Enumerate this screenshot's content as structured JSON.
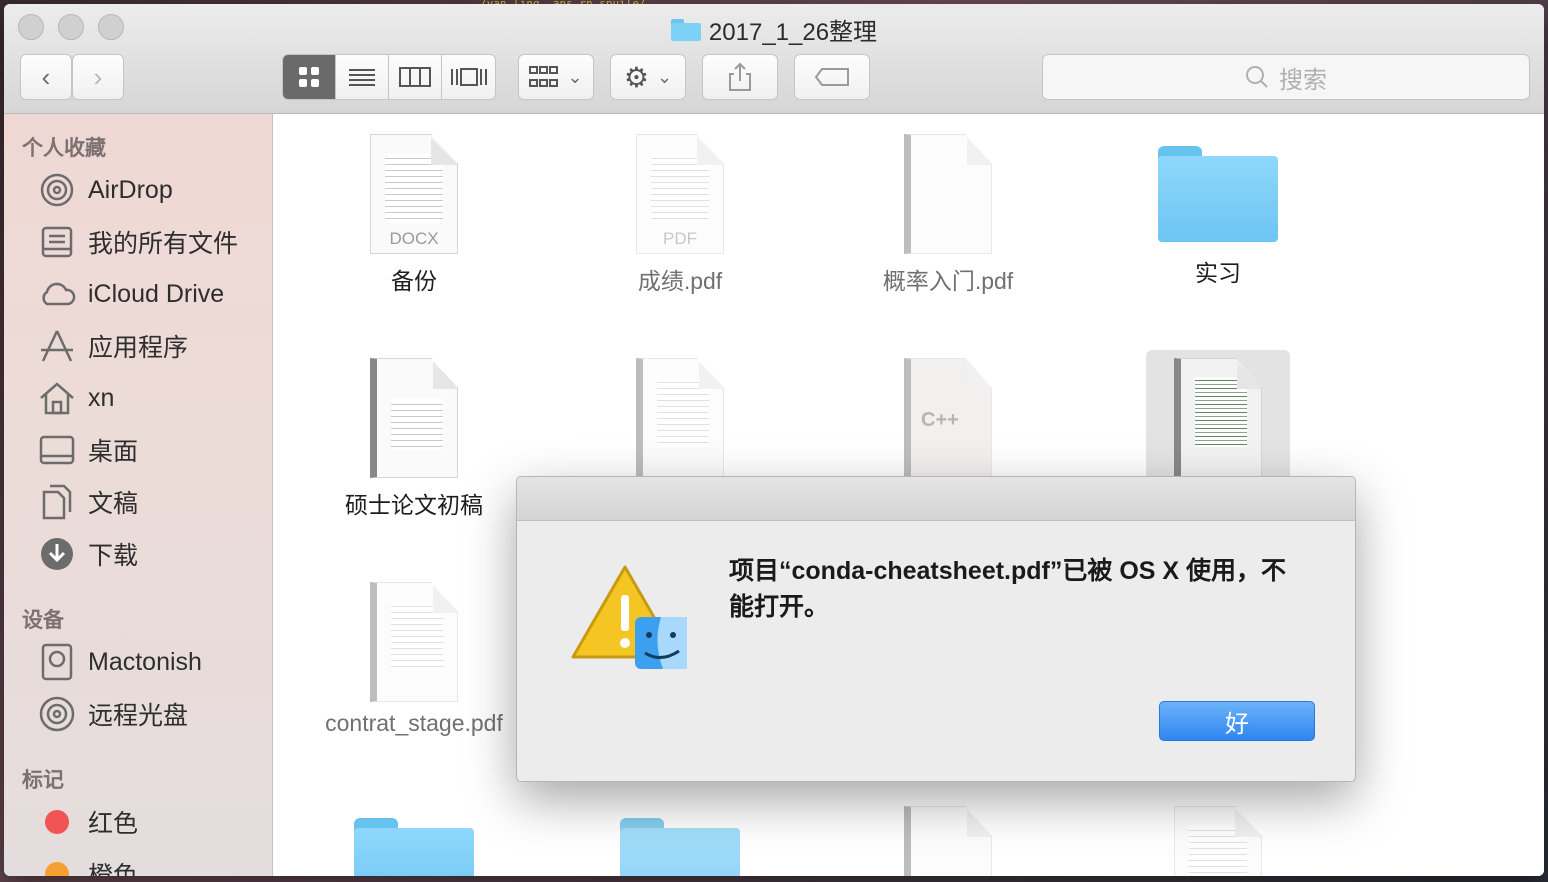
{
  "background_text": "/yan.ling. ans.rn.spuile/",
  "window": {
    "title": "2017_1_26整理"
  },
  "toolbar": {
    "back_icon": "chevron-left-icon",
    "forward_icon": "chevron-right-icon",
    "view_modes": [
      "icon-view",
      "list-view",
      "column-view",
      "cover-flow-view"
    ],
    "active_view": "icon-view",
    "search_placeholder": "搜索"
  },
  "sidebar": {
    "favorites_header": "个人收藏",
    "favorites": [
      {
        "label": "AirDrop",
        "icon": "airdrop-icon"
      },
      {
        "label": "我的所有文件",
        "icon": "all-files-icon"
      },
      {
        "label": "iCloud Drive",
        "icon": "cloud-icon"
      },
      {
        "label": "应用程序",
        "icon": "applications-icon"
      },
      {
        "label": "xn",
        "icon": "home-icon"
      },
      {
        "label": "桌面",
        "icon": "desktop-icon"
      },
      {
        "label": "文稿",
        "icon": "documents-icon"
      },
      {
        "label": "下载",
        "icon": "download-icon"
      }
    ],
    "devices_header": "设备",
    "devices": [
      {
        "label": "Mactonish",
        "icon": "hard-drive-icon"
      },
      {
        "label": "远程光盘",
        "icon": "disc-icon"
      }
    ],
    "tags_header": "标记",
    "tags": [
      {
        "label": "红色",
        "color": "#f05454"
      },
      {
        "label": "橙色",
        "color": "#f5a030"
      }
    ]
  },
  "files": [
    {
      "name": "备份",
      "type": "DOCX"
    },
    {
      "name": "成绩.pdf",
      "type": "PDF"
    },
    {
      "name": "概率入门.pdf",
      "type": "pdf"
    },
    {
      "name": "实习",
      "type": "folder"
    },
    {
      "name": "硕士论文初稿",
      "type": "doc"
    },
    {
      "name": "",
      "type": "pdf"
    },
    {
      "name": "",
      "type": "pdf",
      "thumb_text": "C++"
    },
    {
      "name": "",
      "type": "pdf"
    },
    {
      "name": "contrat_stage.pdf",
      "type": "pdf"
    }
  ],
  "dialog": {
    "message": "项目“conda-cheatsheet.pdf”已被 OS X 使用，不能打开。",
    "ok_label": "好",
    "icon": "warning-finder-icon"
  }
}
